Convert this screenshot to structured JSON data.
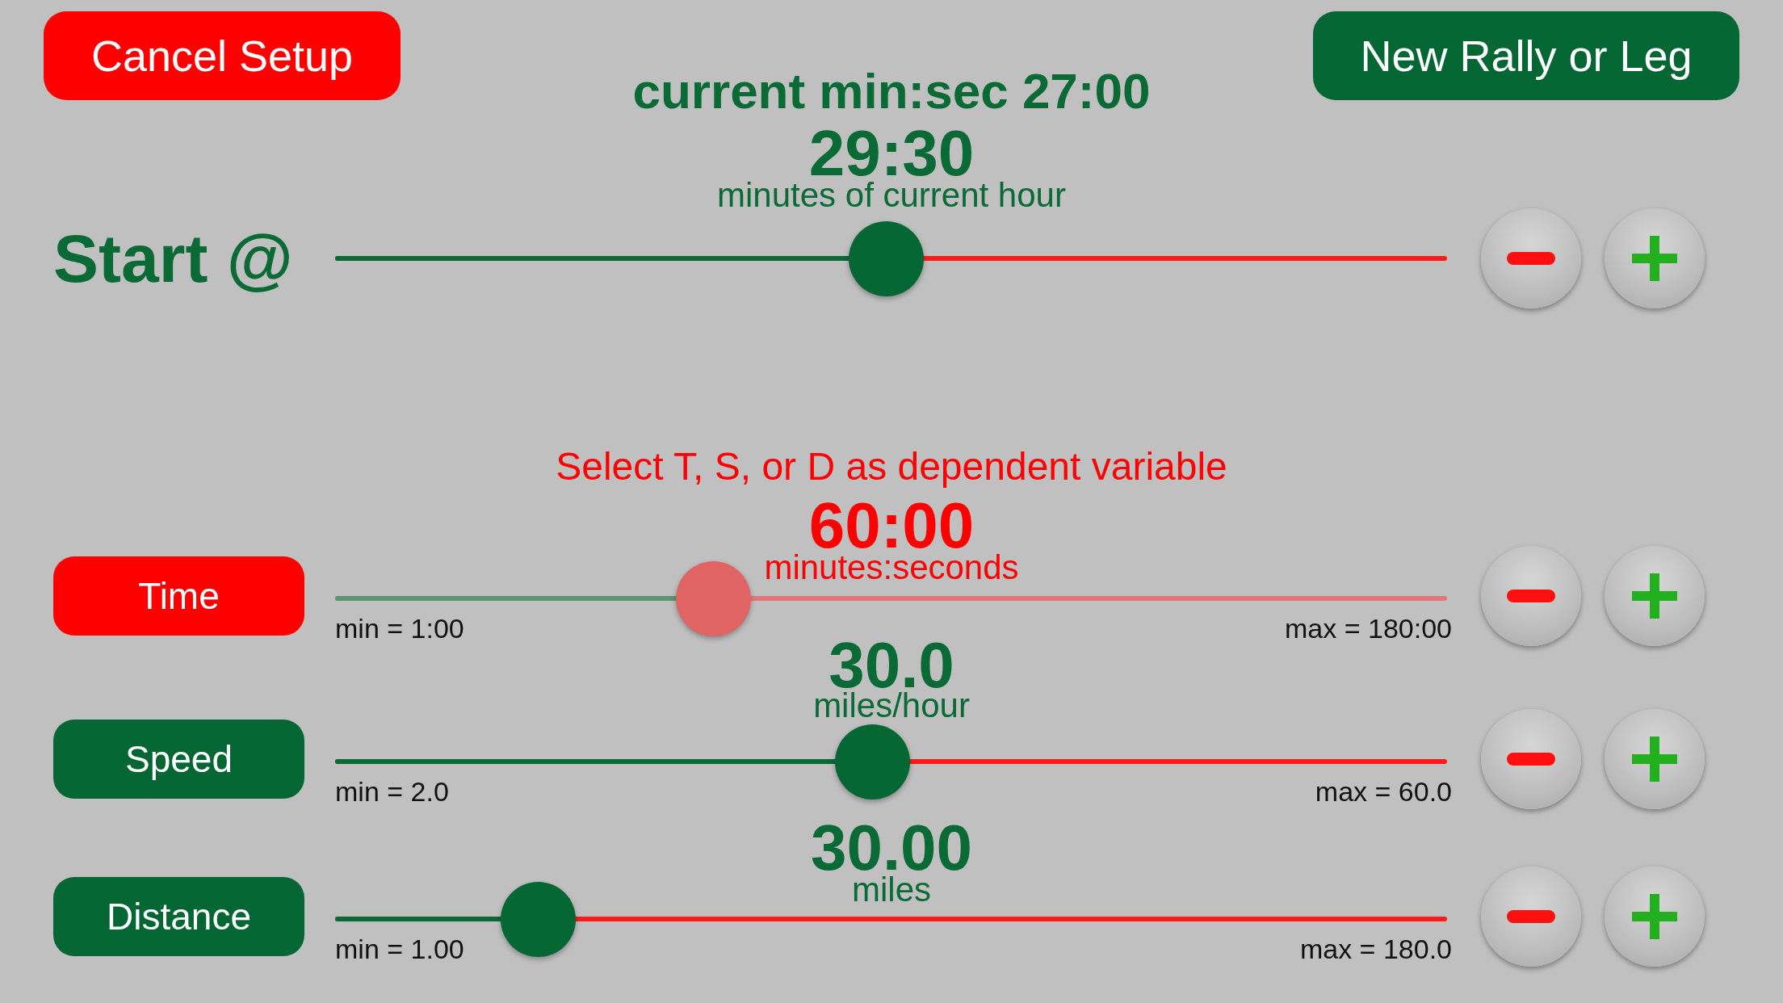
{
  "header": {
    "cancel_button": "Cancel Setup",
    "new_button": "New Rally or Leg",
    "current_time": "current min:sec 27:00"
  },
  "start": {
    "label": "Start @",
    "value": "29:30",
    "units": "minutes of current hour",
    "level": 0.495
  },
  "prompt": "Select T, S, or D as dependent variable",
  "variables": [
    {
      "label": "Time",
      "selected": true,
      "value": "60:00",
      "units": "minutes:seconds",
      "min": "min = 1:00",
      "max": "max = 180:00",
      "level": 0.34
    },
    {
      "label": "Speed",
      "selected": false,
      "value": "30.0",
      "units": "miles/hour",
      "min": "min = 2.0",
      "max": "max = 60.0",
      "level": 0.483
    },
    {
      "label": "Distance",
      "selected": false,
      "value": "30.00",
      "units": "miles",
      "min": "min = 1.00",
      "max": "max = 180.0",
      "level": 0.182
    }
  ]
}
